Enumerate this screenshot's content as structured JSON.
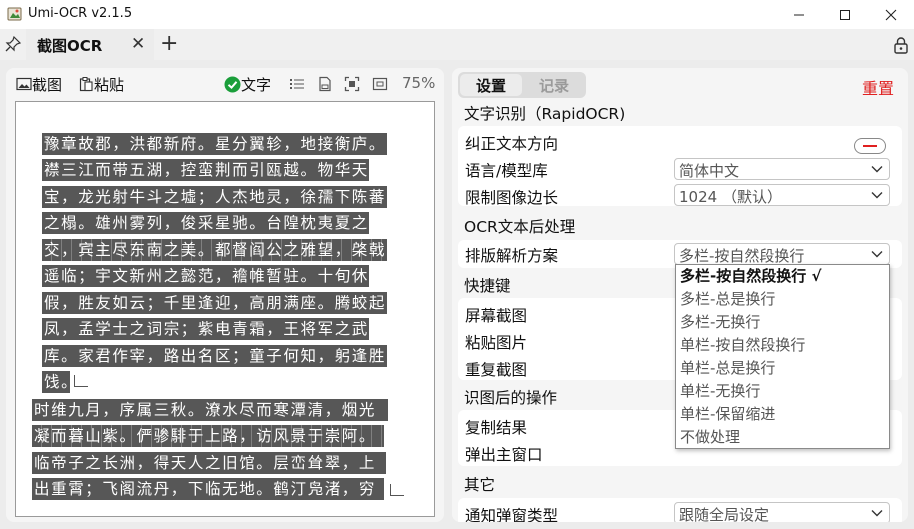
{
  "window": {
    "title": "Umi-OCR v2.1.5",
    "minimize": "—",
    "maximize": "☐",
    "close": "✕"
  },
  "tabs": {
    "active_label": "截图OCR",
    "close_glyph": "✕",
    "add_glyph": "+"
  },
  "left": {
    "screenshot_label": "截图",
    "paste_label": "粘贴",
    "text_label": "文字",
    "zoom": "75%",
    "ocr_lines": [
      "豫章故郡，洪都新府。星分翼轸，地接衡庐。",
      "襟三江而带五湖，控蛮荆而引瓯越。物华天",
      "宝，龙光射牛斗之墟；人杰地灵，徐孺下陈蕃",
      "之榻。雄州雾列，俊采星驰。台隍枕夷夏之",
      "交，宾主尽东南之美。都督阎公之雅望，棨戟",
      "遥临；宇文新州之懿范，襜帷暂驻。十旬休",
      "假，胜友如云；千里逢迎，高朋满座。腾蛟起",
      "凤，孟学士之词宗；紫电青霜，王将军之武",
      "库。家君作宰，路出名区；童子何知，躬逢胜",
      "饯。",
      "时维九月，序属三秋。潦水尽而寒潭清，烟光",
      "凝而暮山紫。俨骖騑于上路，访风景于崇阿。",
      "临帝子之长洲，得天人之旧馆。层峦耸翠，上",
      "出重霄；飞阁流丹，下临无地。鹤汀凫渚，穷"
    ]
  },
  "right": {
    "tab_settings": "设置",
    "tab_log": "记录",
    "reset": "重置",
    "section_ocr": "文字识别（RapidOCR)",
    "row_correct_direction": "纠正文本方向",
    "row_language": "语言/模型库",
    "language_value": "简体中文",
    "row_limit_side": "限制图像边长",
    "limit_side_value": "1024 （默认）",
    "section_post": "OCR文本后处理",
    "row_layout": "排版解析方案",
    "layout_value": "多栏-按自然段换行",
    "section_hotkey": "快捷键",
    "row_screen_capture": "屏幕截图",
    "row_paste_image": "粘贴图片",
    "row_repeat_capture": "重复截图",
    "section_after": "识图后的操作",
    "row_copy_result": "复制结果",
    "row_popup_main": "弹出主窗口",
    "section_other": "其它",
    "row_notify_type": "通知弹窗类型",
    "notify_value": "跟随全局设定"
  },
  "dropdown": {
    "options": [
      "多栏-按自然段换行 √",
      "多栏-总是换行",
      "多栏-无换行",
      "单栏-按自然段换行",
      "单栏-总是换行",
      "单栏-无换行",
      "单栏-保留缩进",
      "不做处理"
    ],
    "selected_index": 0
  },
  "colors": {
    "accent_green": "#1a9e3a",
    "reset_red": "#e02020",
    "ocr_highlight": "#575757"
  },
  "icons": [
    "app-icon",
    "pin-icon",
    "lock-icon",
    "image-icon",
    "clipboard-icon",
    "check-circle-icon",
    "list-icon",
    "document-icon",
    "fit-screen-icon",
    "actual-size-icon",
    "chevron-down-icon",
    "check-icon",
    "paragraph-mark-icon"
  ]
}
